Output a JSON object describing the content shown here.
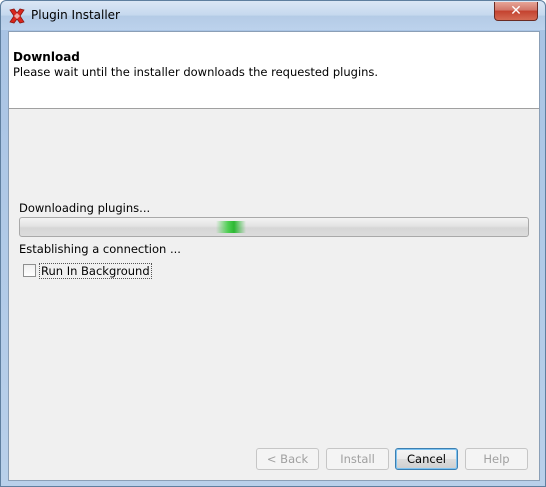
{
  "window": {
    "title": "Plugin Installer",
    "close_label": "✕"
  },
  "header": {
    "title": "Download",
    "description": "Please wait until the installer downloads the requested plugins."
  },
  "progress": {
    "status": "Downloading plugins...",
    "detail": "Establishing a connection ...",
    "mode": "indeterminate"
  },
  "options": {
    "run_in_background_label": "Run In Background",
    "run_in_background_checked": false
  },
  "buttons": {
    "back": "< Back",
    "install": "Install",
    "cancel": "Cancel",
    "help": "Help"
  },
  "colors": {
    "progress_accent": "#2cb833",
    "icon_accent": "#d9261c"
  },
  "icons": {
    "app": "red-x-plugin-icon"
  }
}
